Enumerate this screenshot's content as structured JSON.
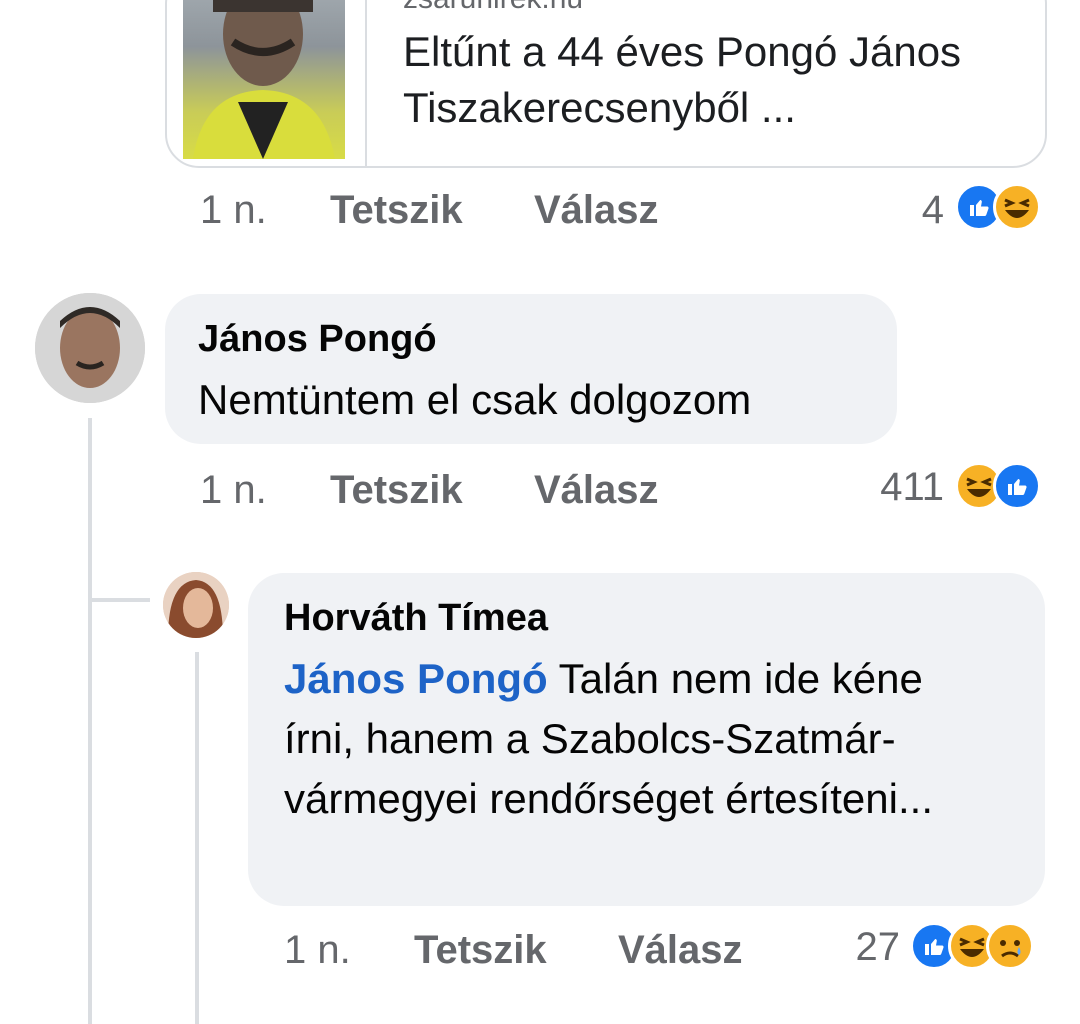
{
  "link_preview": {
    "domain": "zsaruhirek.hu",
    "title": "Eltűnt a 44 éves Pongó János Tiszakerecsenyből ..."
  },
  "post_actions": {
    "time": "1 n.",
    "like": "Tetszik",
    "reply": "Válasz",
    "count": "4"
  },
  "comment1": {
    "author": "János Pongó",
    "text": "Nemtüntem el csak dolgozom",
    "time": "1 n.",
    "like": "Tetszik",
    "reply": "Válasz",
    "count": "411"
  },
  "comment2": {
    "author": "Horváth Tímea",
    "mention": "János Pongó",
    "text": " Talán nem ide kéne írni, hanem a Szabolcs-Szatmár-vármegyei rendőrséget értesíteni...",
    "time": "1 n.",
    "like": "Tetszik",
    "reply": "Válasz",
    "count": "27"
  },
  "colors": {
    "like_blue": "#1877f2",
    "emoji_yellow": "#f7b125",
    "mention_blue": "#1d63c7",
    "bubble_gray": "#f0f2f5",
    "meta_gray": "#65676b"
  },
  "icons": {
    "post_reactions": [
      "like-icon",
      "haha-icon"
    ],
    "comment1_reactions": [
      "haha-icon",
      "like-icon"
    ],
    "comment2_reactions": [
      "like-icon",
      "haha-icon",
      "sad-icon"
    ]
  }
}
